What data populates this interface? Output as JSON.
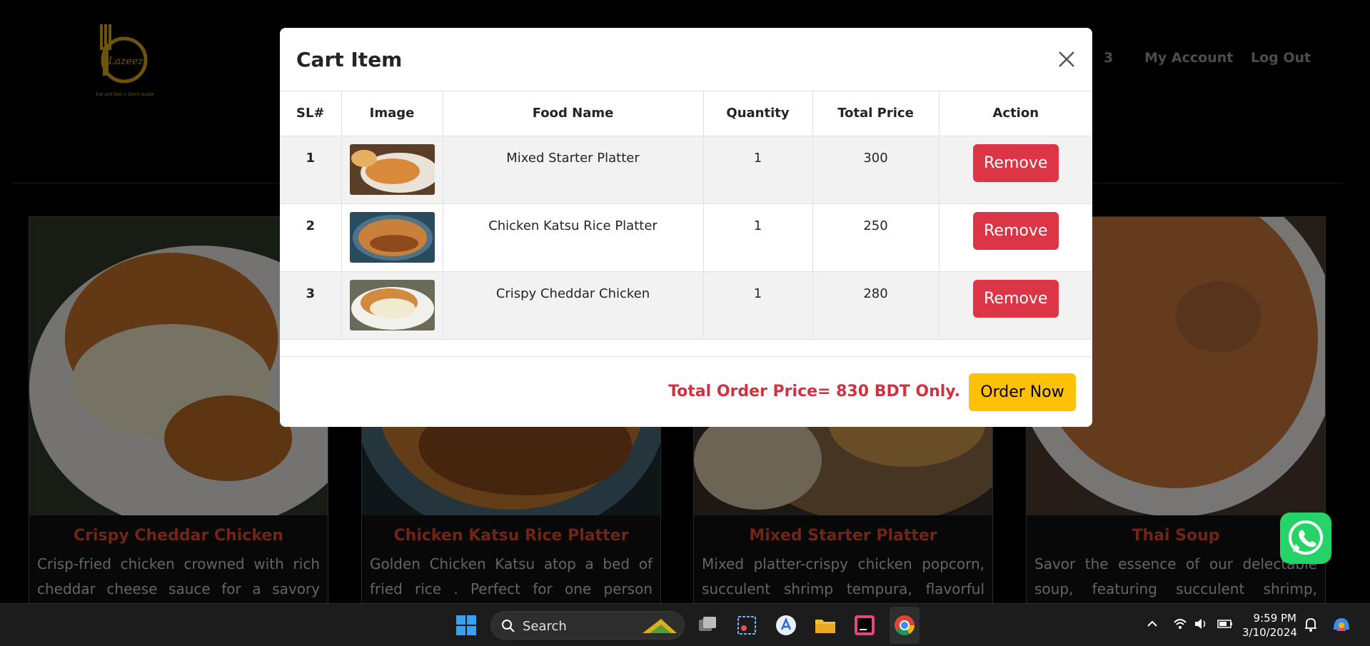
{
  "header": {
    "logo_text": "Lazeez",
    "logo_tagline": "Eat and feel + Don't waste",
    "cart_count": "3",
    "my_account": "My Account",
    "log_out": "Log Out"
  },
  "cards": [
    {
      "title": "Crispy Cheddar Chicken",
      "desc": "Crisp-fried chicken crowned with rich cheddar cheese sauce for a savory delight."
    },
    {
      "title": "Chicken Katsu Rice Platter",
      "desc": "Golden Chicken Katsu atop a bed of fried rice . Perfect for one person lunch."
    },
    {
      "title": "Mixed Starter Platter",
      "desc": "Mixed platter-crispy chicken popcorn, succulent shrimp tempura, flavorful spring"
    },
    {
      "title": "Thai Soup",
      "desc": "Savor the essence of our delectable soup, featuring succulent shrimp, earthy"
    }
  ],
  "modal": {
    "title": "Cart Item",
    "columns": [
      "SL#",
      "Image",
      "Food Name",
      "Quantity",
      "Total Price",
      "Action"
    ],
    "rows": [
      {
        "sl": "1",
        "food": "Mixed Starter Platter",
        "qty": "1",
        "price": "300",
        "action": "Remove"
      },
      {
        "sl": "2",
        "food": "Chicken Katsu Rice Platter",
        "qty": "1",
        "price": "250",
        "action": "Remove"
      },
      {
        "sl": "3",
        "food": "Crispy Cheddar Chicken",
        "qty": "1",
        "price": "280",
        "action": "Remove"
      }
    ],
    "total_text": "Total Order Price= 830 BDT Only.",
    "order_button": "Order Now"
  },
  "taskbar": {
    "search_label": "Search",
    "time": "9:59 PM",
    "date": "3/10/2024"
  },
  "colors": {
    "accent_red": "#dc3545",
    "order_yellow": "#ffc107",
    "card_title": "#e04a2a",
    "total_red": "#d0323f"
  }
}
